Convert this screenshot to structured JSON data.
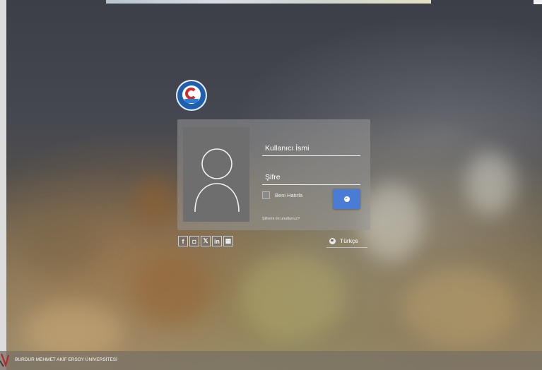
{
  "login": {
    "username_placeholder": "Kullanıcı İsmi",
    "password_placeholder": "Şifre",
    "remember_label": "Beni Hatırla",
    "forgot_link": "Şifremi mi unuttunuz?"
  },
  "social": {
    "items": [
      "f",
      "◘",
      "𝕏",
      "in",
      "▦"
    ]
  },
  "language": {
    "selected": "Türkçe"
  },
  "footer": {
    "title": "BURDUR MEHMET AKİF ERSOY ÜNİVERSİTESİ"
  },
  "colors": {
    "accent": "#4a7cd6",
    "logo_blue": "#1f5fae",
    "logo_red": "#d62828"
  }
}
